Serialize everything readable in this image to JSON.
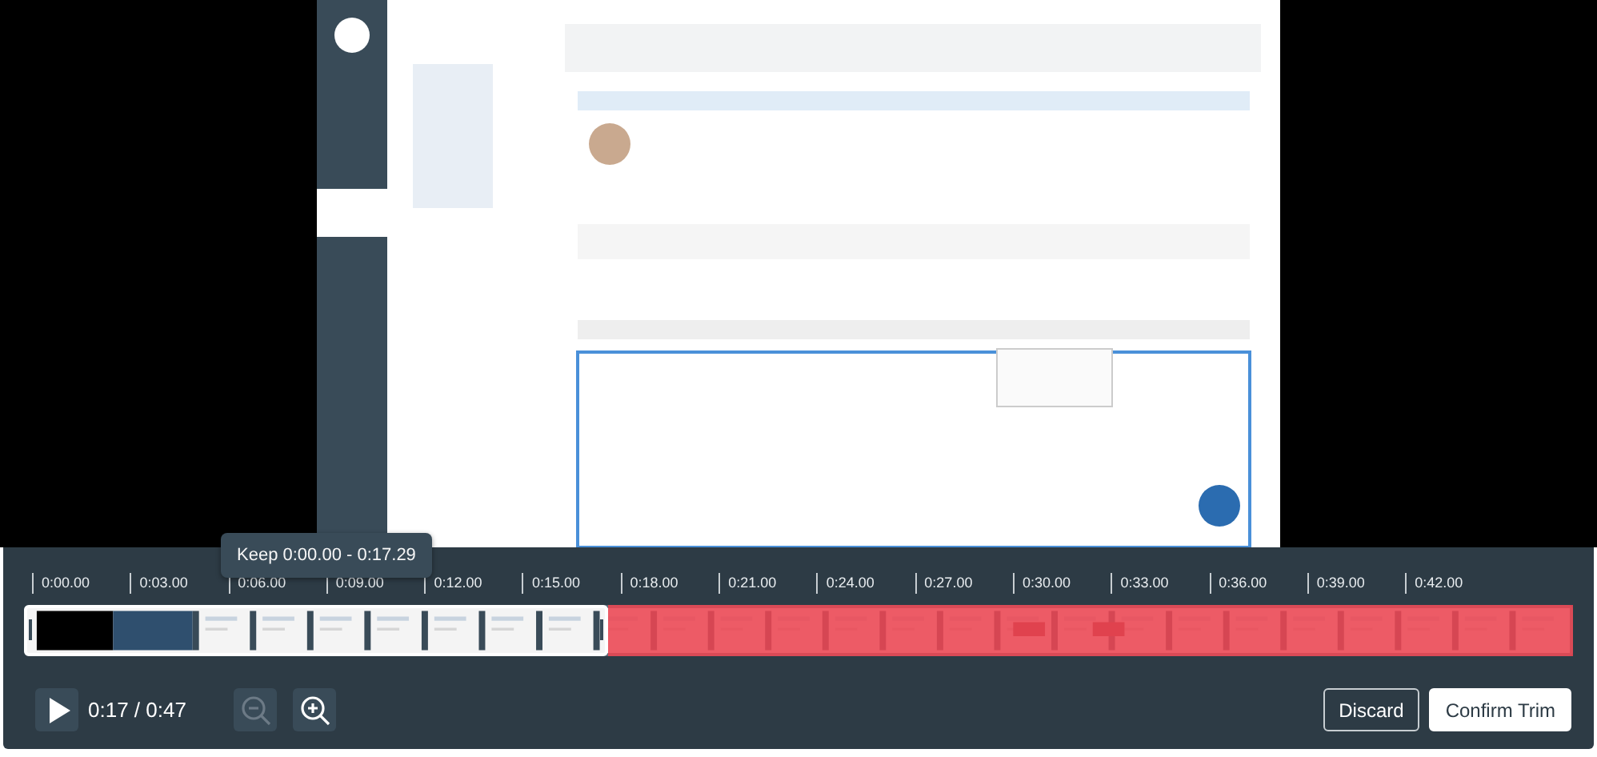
{
  "tooltip": {
    "text": "Keep 0:00.00 - 0:17.29"
  },
  "ticks": [
    "0:00.00",
    "0:03.00",
    "0:06.00",
    "0:09.00",
    "0:12.00",
    "0:15.00",
    "0:18.00",
    "0:21.00",
    "0:24.00",
    "0:27.00",
    "0:30.00",
    "0:33.00",
    "0:36.00",
    "0:39.00",
    "0:42.00"
  ],
  "trim": {
    "level": 0.377
  },
  "playback": {
    "time": "0:17 / 0:47"
  },
  "zoom_out": {
    "disabled": true
  },
  "zoom_in": {
    "disabled": false
  },
  "buttons": [
    {
      "label": "Discard",
      "kind": "secondary"
    },
    {
      "label": "Confirm Trim",
      "kind": "primary"
    }
  ]
}
